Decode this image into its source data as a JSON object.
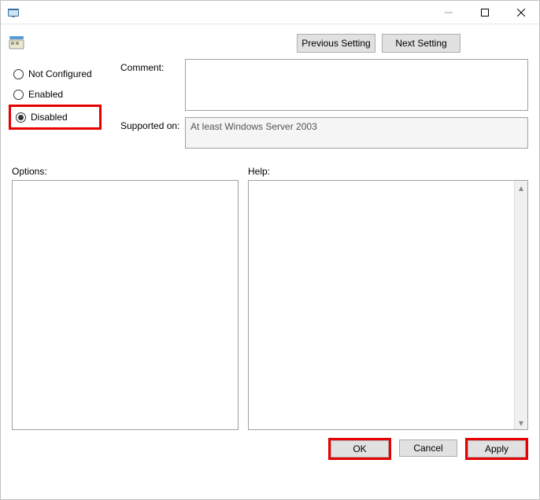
{
  "titlebar": {
    "title": ""
  },
  "nav": {
    "prev_label": "Previous Setting",
    "next_label": "Next Setting"
  },
  "radio": {
    "not_configured": "Not Configured",
    "enabled": "Enabled",
    "disabled": "Disabled",
    "selected": "disabled"
  },
  "fields": {
    "comment_label": "Comment:",
    "comment_value": "",
    "supported_label": "Supported on:",
    "supported_value": "At least Windows Server 2003"
  },
  "panels": {
    "options_label": "Options:",
    "help_label": "Help:",
    "options_text": "",
    "help_text": ""
  },
  "buttons": {
    "ok": "OK",
    "cancel": "Cancel",
    "apply": "Apply"
  }
}
